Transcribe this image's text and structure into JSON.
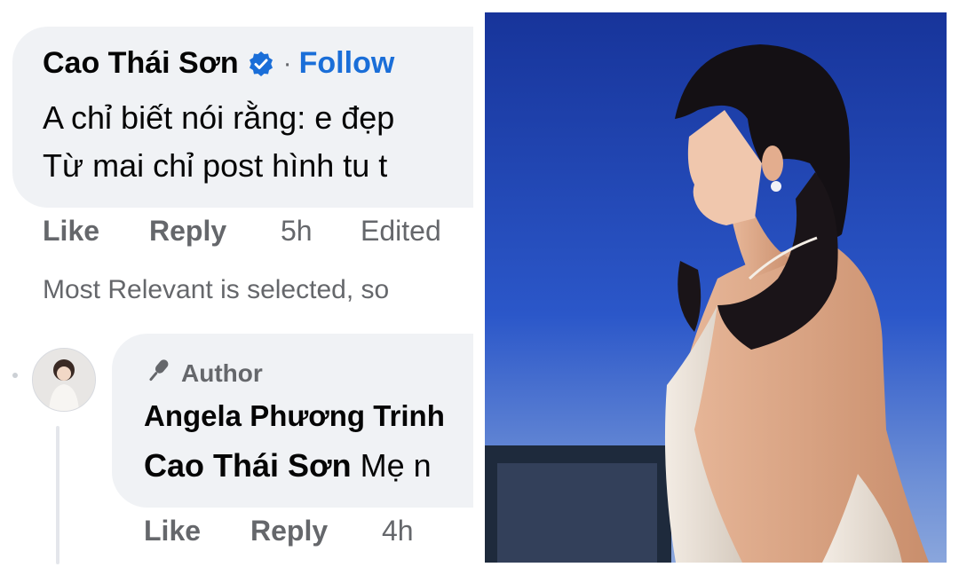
{
  "comment": {
    "author": "Cao Thái Sơn",
    "separator": "·",
    "follow_label": "Follow",
    "line1": "A chỉ biết nói rằng: e đẹp",
    "line2": "Từ mai chỉ post hình tu t",
    "actions": {
      "like": "Like",
      "reply": "Reply",
      "time": "5h",
      "edited": "Edited"
    }
  },
  "sort_note": "Most Relevant is selected, so",
  "reply": {
    "badge": "Author",
    "author": "Angela Phương Trinh",
    "mention": "Cao Thái Sơn",
    "text": "Mẹ n",
    "actions": {
      "like": "Like",
      "reply": "Reply",
      "time": "4h"
    }
  },
  "colors": {
    "link": "#1a6ed8",
    "bubble": "#f0f2f5",
    "muted": "#65676b",
    "text": "#050505"
  },
  "icons": {
    "verified": "verified-badge-icon",
    "author": "microphone-icon"
  }
}
